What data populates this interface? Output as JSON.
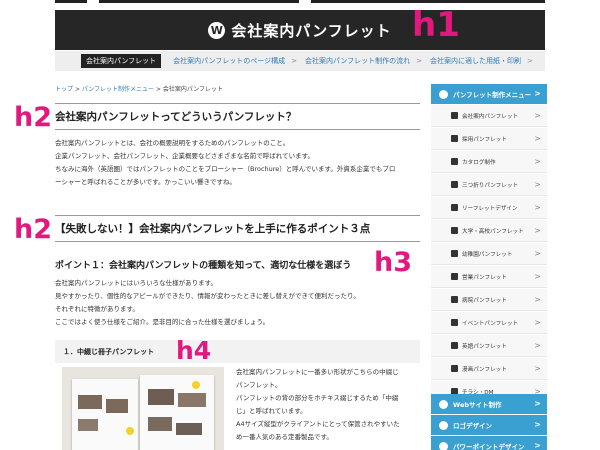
{
  "header": {
    "logo_glyph": "W",
    "title": "会社案内パンフレット"
  },
  "annotations": {
    "h1": "h1",
    "h2a": "h2",
    "h2b": "h2",
    "h3": "h3",
    "h4": "h4"
  },
  "nav": {
    "current": "会社案内パンフレット",
    "links": [
      "会社案内パンフレットのページ構成",
      "会社案内パンフレット制作の流れ",
      "会社案内に適した用紙・印刷"
    ],
    "separator": ">"
  },
  "breadcrumb": {
    "items": [
      "トップ",
      "パンフレット制作メニュー",
      "会社案内パンフレット"
    ],
    "separator": ">"
  },
  "section1": {
    "heading": "会社案内パンフレットってどういうパンフレット？",
    "lines": [
      "会社案内パンフレットとは、会社の概要説明をするためのパンフレットのこと。",
      "企業パンフレット、会社パンフレット、企業概要などさまざまな名前で呼ばれています。",
      "ちなみに海外（英語圏）ではパンフレットのことをブローシャー（Brochure）と呼んでいます。外資系企業でもブロ",
      "ーシャーと呼ばれることが多いです。かっこいい響きですね。"
    ]
  },
  "section2": {
    "heading": "【失敗しない！】会社案内パンフレットを上手に作るポイント３点"
  },
  "point1": {
    "heading": "ポイント１：会社案内パンフレットの種類を知って、適切な仕様を選ぼう",
    "lines": [
      "会社案内パンフレットにはいろいろな仕様があります。",
      "見やすかったり、個性的なアピールができたり、情報が変わったときに差し替えができて便利だったり。",
      "それぞれに特徴があります。",
      "ここではよく使う仕様をご紹介。是非目的に合った仕様を選びましょう。"
    ]
  },
  "subsection1": {
    "heading": "１．中綴じ冊子パンフレット",
    "lines": [
      "会社案内パンフレットに一番多い形状がこちらの中綴じ",
      "パンフレット。",
      "パンフレットの背の部分をホチキス綴じするため「中綴",
      "じ」と呼ばれています。",
      "A4サイズ縦型がクライアントにとって保管されやすいた",
      "め一番人気のある定番製品です。"
    ]
  },
  "sidebar": {
    "menu_title": "パンフレット制作メニュー",
    "items": [
      {
        "label": "会社案内パンフレット",
        "icon": "building-icon"
      },
      {
        "label": "採用パンフレット",
        "icon": "search-person-icon"
      },
      {
        "label": "カタログ制作",
        "icon": "book-icon"
      },
      {
        "label": "三つ折りパンフレット",
        "icon": "fold-icon"
      },
      {
        "label": "リーフレットデザイン",
        "icon": "leaflet-icon"
      },
      {
        "label": "大学・高校パンフレット",
        "icon": "school-icon"
      },
      {
        "label": "幼稚園パンフレット",
        "icon": "kindergarten-icon"
      },
      {
        "label": "営業パンフレット",
        "icon": "sales-icon"
      },
      {
        "label": "病院パンフレット",
        "icon": "hospital-icon"
      },
      {
        "label": "イベントパンフレット",
        "icon": "event-icon"
      },
      {
        "label": "英語パンフレット",
        "icon": "english-icon"
      },
      {
        "label": "漫画パンフレット",
        "icon": "manga-icon"
      },
      {
        "label": "チラシ・DM",
        "icon": "flyer-icon"
      }
    ],
    "bottom_menus": [
      "Webサイト制作",
      "ロゴデザイン",
      "パワーポイントデザイン"
    ],
    "chevron": ">"
  },
  "colors": {
    "header_bg": "#262626",
    "accent_blue": "#3a9fd1",
    "annotation_pink": "#e2187f",
    "link": "#2b7bb9"
  }
}
